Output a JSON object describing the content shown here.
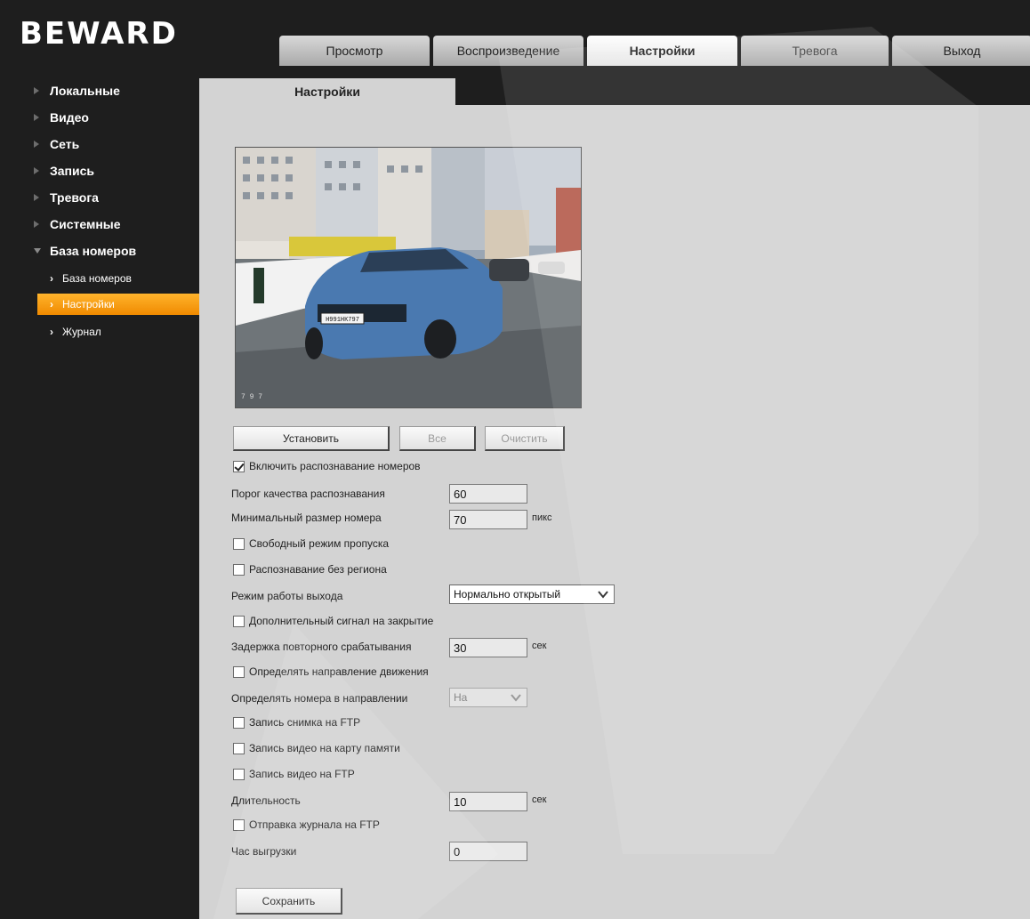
{
  "logo": "BEWARD",
  "tabs": [
    "Просмотр",
    "Воспроизведение",
    "Настройки",
    "Тревога",
    "Выход"
  ],
  "page_tab": "Настройки",
  "sidebar": {
    "items": [
      "Локальные",
      "Видео",
      "Сеть",
      "Запись",
      "Тревога",
      "Системные",
      "База номеров"
    ],
    "sub_items": [
      "База номеров",
      "Настройки",
      "Журнал"
    ]
  },
  "camera": {
    "plate": "Н991НК797",
    "timestamp": "7 9 7"
  },
  "buttons": {
    "set": "Установить",
    "all": "Все",
    "clear": "Очистить",
    "save": "Сохранить"
  },
  "form": {
    "enable_recognition": "Включить распознавание номеров",
    "quality_threshold_label": "Порог качества распознавания",
    "quality_threshold_value": "60",
    "min_size_label": "Минимальный размер номера",
    "min_size_value": "70",
    "min_size_unit": "пикс",
    "free_pass": "Свободный режим пропуска",
    "no_region": "Распознавание без региона",
    "output_mode_label": "Режим работы выхода",
    "output_mode_value": "Нормально открытый",
    "extra_signal": "Дополнительный сигнал на закрытие",
    "retrigger_label": "Задержка повторного срабатывания",
    "retrigger_value": "30",
    "retrigger_unit": "сек",
    "direction_detect": "Определять направление движения",
    "direction_label": "Определять номера в направлении",
    "direction_value": "На",
    "ftp_snapshot": "Запись снимка на FTP",
    "sd_video": "Запись видео на карту памяти",
    "ftp_video": "Запись видео на FTP",
    "duration_label": "Длительность",
    "duration_value": "10",
    "duration_unit": "сек",
    "ftp_log": "Отправка журнала на FTP",
    "upload_hour_label": "Час выгрузки",
    "upload_hour_value": "0"
  }
}
